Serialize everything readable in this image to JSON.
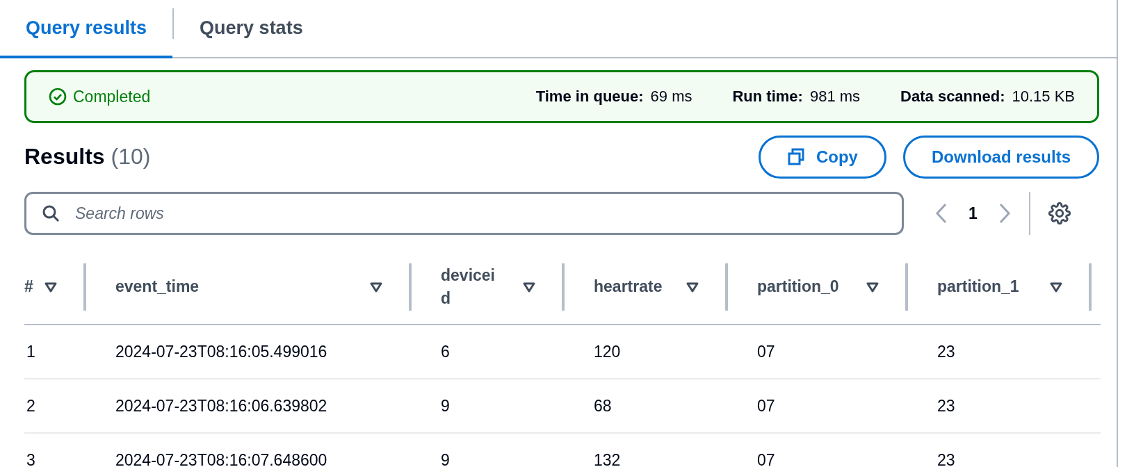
{
  "tabs": [
    {
      "label": "Query results",
      "selected": true
    },
    {
      "label": "Query stats",
      "selected": false
    }
  ],
  "status": {
    "succeeded": true,
    "label": "Completed",
    "metrics": [
      {
        "label": "Time in queue:",
        "value": "69 ms"
      },
      {
        "label": "Run time:",
        "value": "981 ms"
      },
      {
        "label": "Data scanned:",
        "value": "10.15 KB"
      }
    ]
  },
  "results": {
    "title": "Results",
    "count": "(10)"
  },
  "buttons": [
    {
      "kind": "copy",
      "label": "Copy"
    },
    {
      "kind": "plain",
      "label": "Download results"
    }
  ],
  "search": {
    "placeholder": "Search rows"
  },
  "pagination": {
    "page": "1"
  },
  "table": {
    "columns": [
      "#",
      "event_time",
      "deviceid",
      "heartrate",
      "partition_0",
      "partition_1"
    ],
    "rows": [
      [
        "1",
        "2024-07-23T08:16:05.499016",
        "6",
        "120",
        "07",
        "23"
      ],
      [
        "2",
        "2024-07-23T08:16:06.639802",
        "9",
        "68",
        "07",
        "23"
      ],
      [
        "3",
        "2024-07-23T08:16:07.648600",
        "9",
        "132",
        "07",
        "23"
      ]
    ]
  }
}
